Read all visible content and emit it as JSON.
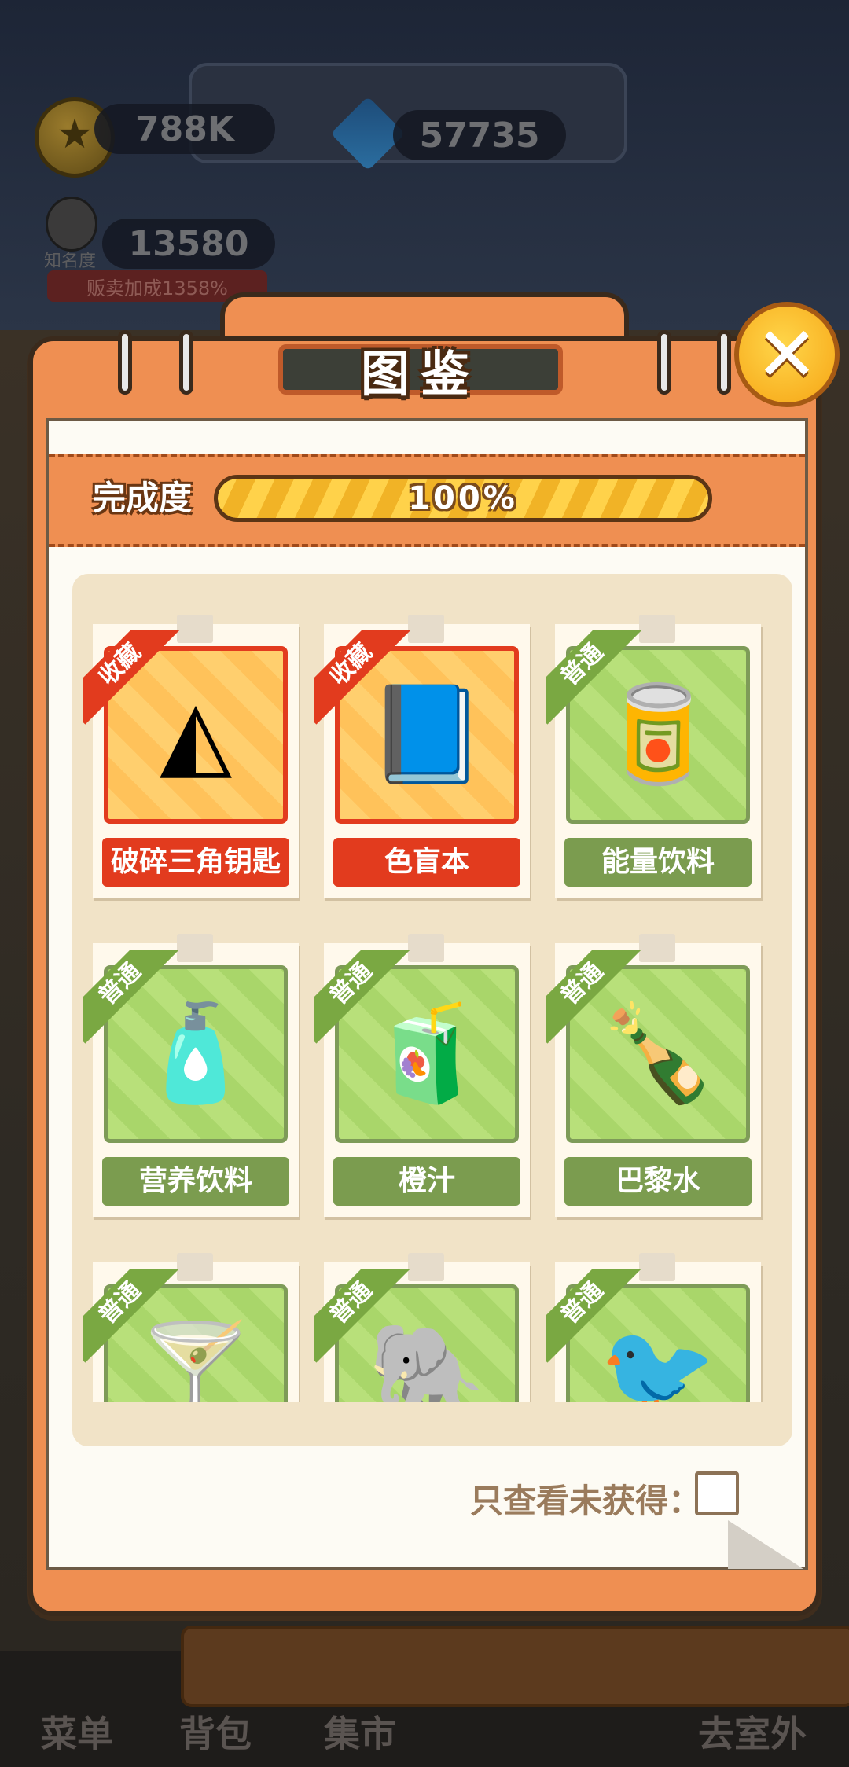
{
  "hud": {
    "coins": "788K",
    "gems": "57735",
    "fame": "13580",
    "fame_label": "知名度",
    "fame_bonus": "贩卖加成1358%"
  },
  "bottom_nav": [
    "菜单",
    "背包",
    "集市",
    "去室外"
  ],
  "modal": {
    "title": "图鉴",
    "close_icon": "close-x-icon",
    "progress_label": "完成度",
    "progress_value": 1.0,
    "progress_text": "100%",
    "filter_label": "只查看未获得：",
    "filter_checked": false
  },
  "items": [
    {
      "name": "破碎三角钥匙",
      "tag": "收藏",
      "rarity": "rare",
      "icon": "broken-triangle-key-icon",
      "glyph": "◭"
    },
    {
      "name": "色盲本",
      "tag": "收藏",
      "rarity": "rare",
      "icon": "color-blind-book-icon",
      "glyph": "📘"
    },
    {
      "name": "能量饮料",
      "tag": "普通",
      "rarity": "common",
      "icon": "energy-drink-can-icon",
      "glyph": "🥫"
    },
    {
      "name": "营养饮料",
      "tag": "普通",
      "rarity": "common",
      "icon": "nutrition-drink-bottle-icon",
      "glyph": "🧴"
    },
    {
      "name": "橙汁",
      "tag": "普通",
      "rarity": "common",
      "icon": "orange-juice-bottle-icon",
      "glyph": "🧃"
    },
    {
      "name": "巴黎水",
      "tag": "普通",
      "rarity": "common",
      "icon": "sparkling-water-bottle-icon",
      "glyph": "🍾"
    },
    {
      "name": "",
      "tag": "普通",
      "rarity": "common",
      "icon": "cocktail-glass-icon",
      "glyph": "🍸"
    },
    {
      "name": "",
      "tag": "普通",
      "rarity": "common",
      "icon": "elephant-plush-icon",
      "glyph": "🐘"
    },
    {
      "name": "",
      "tag": "普通",
      "rarity": "common",
      "icon": "sparrow-bird-icon",
      "glyph": "🐦"
    }
  ],
  "colors": {
    "rare": "#e23b1e",
    "common": "#7b9c4f",
    "modal": "#ef8f52",
    "progress": "#ffd24a"
  }
}
